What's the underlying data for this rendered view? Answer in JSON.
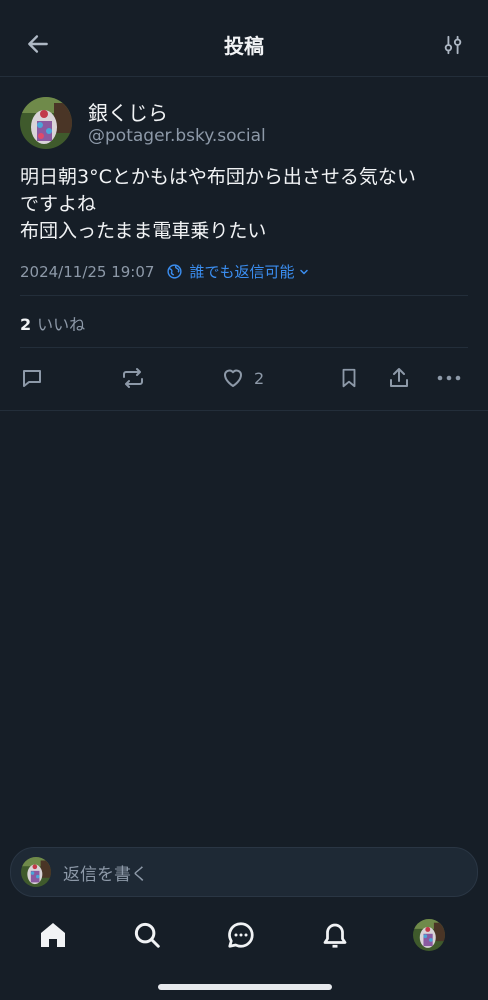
{
  "header": {
    "title": "投稿",
    "back_icon": "arrow-left-icon",
    "filter_icon": "sliders-icon"
  },
  "post": {
    "author_name": "銀くじら",
    "author_handle": "@potager.bsky.social",
    "text": "明日朝3°Cとかもはや布団から出させる気ない\nですよね\n布団入ったまま電車乗りたい",
    "timestamp": "2024/11/25 19:07",
    "reply_setting": "誰でも返信可能",
    "like_count": "2",
    "like_label": "いいね",
    "actions": {
      "reply_icon": "reply-bubble-icon",
      "repost_icon": "repost-icon",
      "like_icon": "heart-icon",
      "like_count": "2",
      "bookmark_icon": "bookmark-icon",
      "share_icon": "share-icon",
      "more_icon": "more-horizontal-icon"
    }
  },
  "composer": {
    "placeholder": "返信を書く"
  },
  "tabbar": {
    "items": [
      {
        "name": "home",
        "icon": "home-icon"
      },
      {
        "name": "search",
        "icon": "search-icon"
      },
      {
        "name": "chat",
        "icon": "chat-icon"
      },
      {
        "name": "notifications",
        "icon": "bell-icon"
      },
      {
        "name": "profile",
        "icon": "avatar"
      }
    ]
  },
  "colors": {
    "background": "#161e27",
    "accent": "#3b8ef0",
    "muted": "#8d99a8",
    "divider": "#232e3a"
  }
}
